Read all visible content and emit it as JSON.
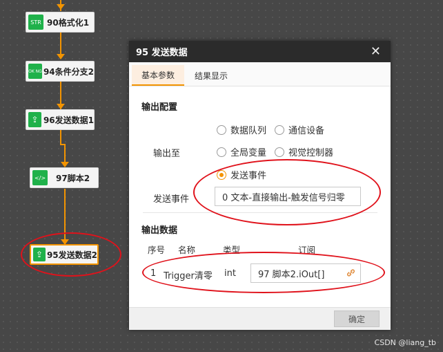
{
  "flow": {
    "nodes": [
      {
        "label": "90格式化1",
        "icon": "format-icon",
        "icon_text": "STR"
      },
      {
        "label": "94条件分支2",
        "icon": "branch-icon",
        "icon_text": "OK NG"
      },
      {
        "label": "96发送数据1",
        "icon": "send-data-icon",
        "icon_text": "⇪"
      },
      {
        "label": "97脚本2",
        "icon": "script-icon",
        "icon_text": "</>"
      },
      {
        "label": "95发送数据2",
        "icon": "send-data-icon",
        "icon_text": "⇪"
      }
    ]
  },
  "dialog": {
    "title": "95 发送数据",
    "close_glyph": "✕",
    "tabs": [
      {
        "label": "基本参数",
        "active": true
      },
      {
        "label": "结果显示",
        "active": false
      }
    ],
    "output_config": {
      "section_title": "输出配置",
      "output_to_label": "输出至",
      "options": [
        {
          "label": "数据队列",
          "selected": false
        },
        {
          "label": "通信设备",
          "selected": false
        },
        {
          "label": "全局变量",
          "selected": false
        },
        {
          "label": "视觉控制器",
          "selected": false
        },
        {
          "label": "发送事件",
          "selected": true
        }
      ],
      "event_label": "发送事件",
      "event_value": "0 文本-直接输出-触发信号归零"
    },
    "output_data": {
      "section_title": "输出数据",
      "columns": [
        "序号",
        "名称",
        "类型",
        "订阅"
      ],
      "rows": [
        {
          "index": "1",
          "name": "Trigger清零",
          "type": "int",
          "subscribe": "97 脚本2.iOut[]"
        }
      ]
    },
    "ok_label": "确定"
  },
  "watermark": "CSDN @liang_tb",
  "colors": {
    "accent": "#f39400",
    "node_green": "#1fb14a",
    "annotation_red": "#e0121b",
    "title_bar": "#2b2b2b"
  }
}
